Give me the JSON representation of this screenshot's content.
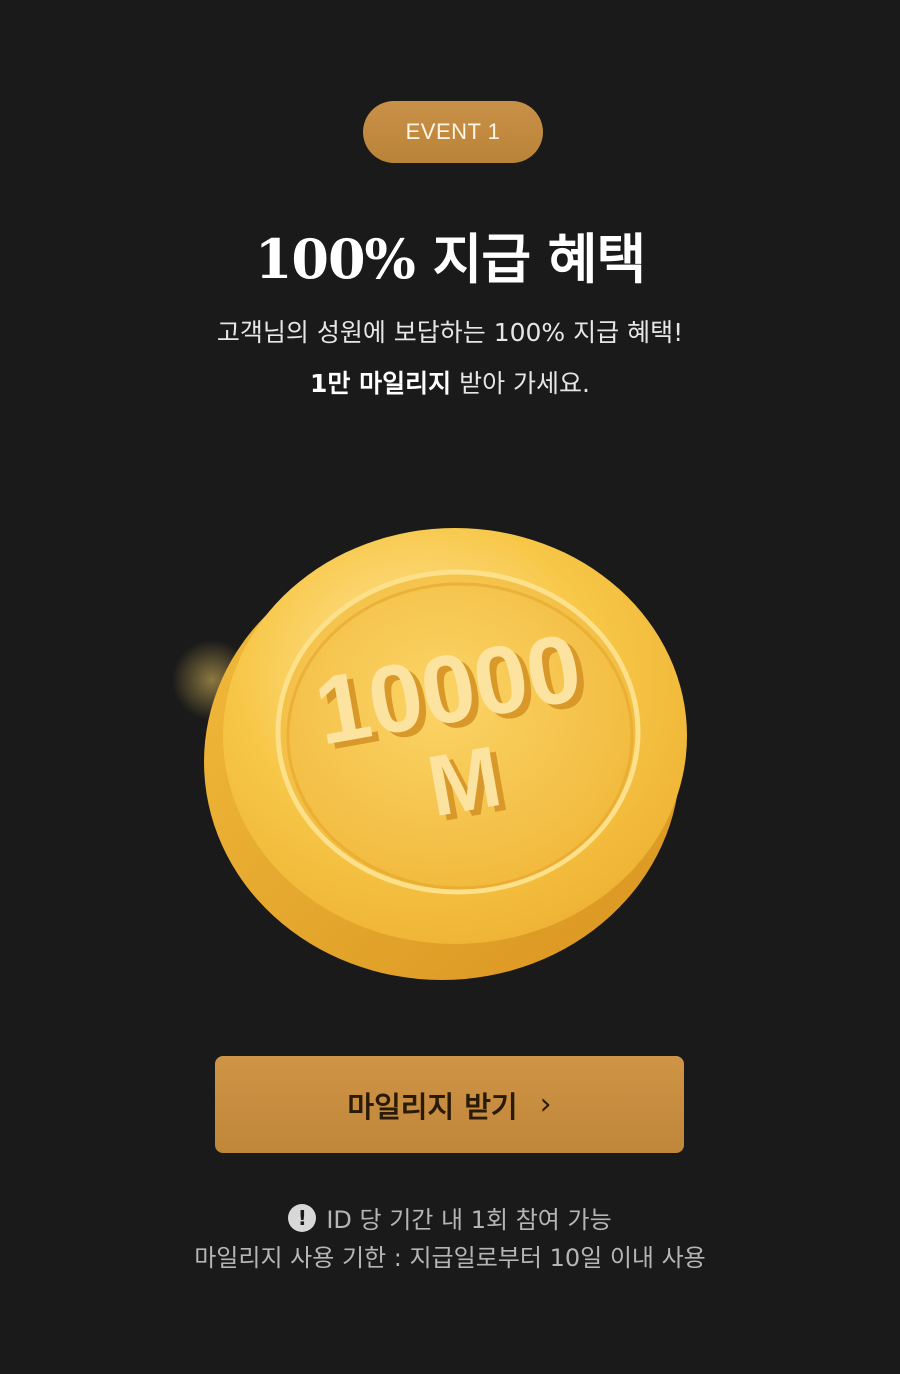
{
  "badge": {
    "label": "EVENT 1"
  },
  "title": "100% 지급 혜택",
  "description": {
    "line1": "고객님의 성원에 보답하는 100% 지급 혜택!",
    "line2_bold": "1만 마일리지",
    "line2_rest": " 받아 가세요."
  },
  "coin": {
    "amount": "10000",
    "unit": "M",
    "icon": "gold-coin-icon",
    "colors": {
      "face": "#f6c443",
      "edge": "#e0a22a",
      "highlight": "#ffe9a3"
    }
  },
  "cta": {
    "label": "마일리지 받기",
    "chevron": "›"
  },
  "notes": {
    "participation": "ID 당 기간 내 1회 참여 가능",
    "expiry": "마일리지 사용 기한 : 지급일로부터 10일 이내 사용",
    "icon_glyph": "!"
  },
  "colors": {
    "background": "#1a1a1a",
    "accent": "#c99148",
    "text_primary": "#ffffff",
    "text_secondary": "#b5b5b5"
  }
}
